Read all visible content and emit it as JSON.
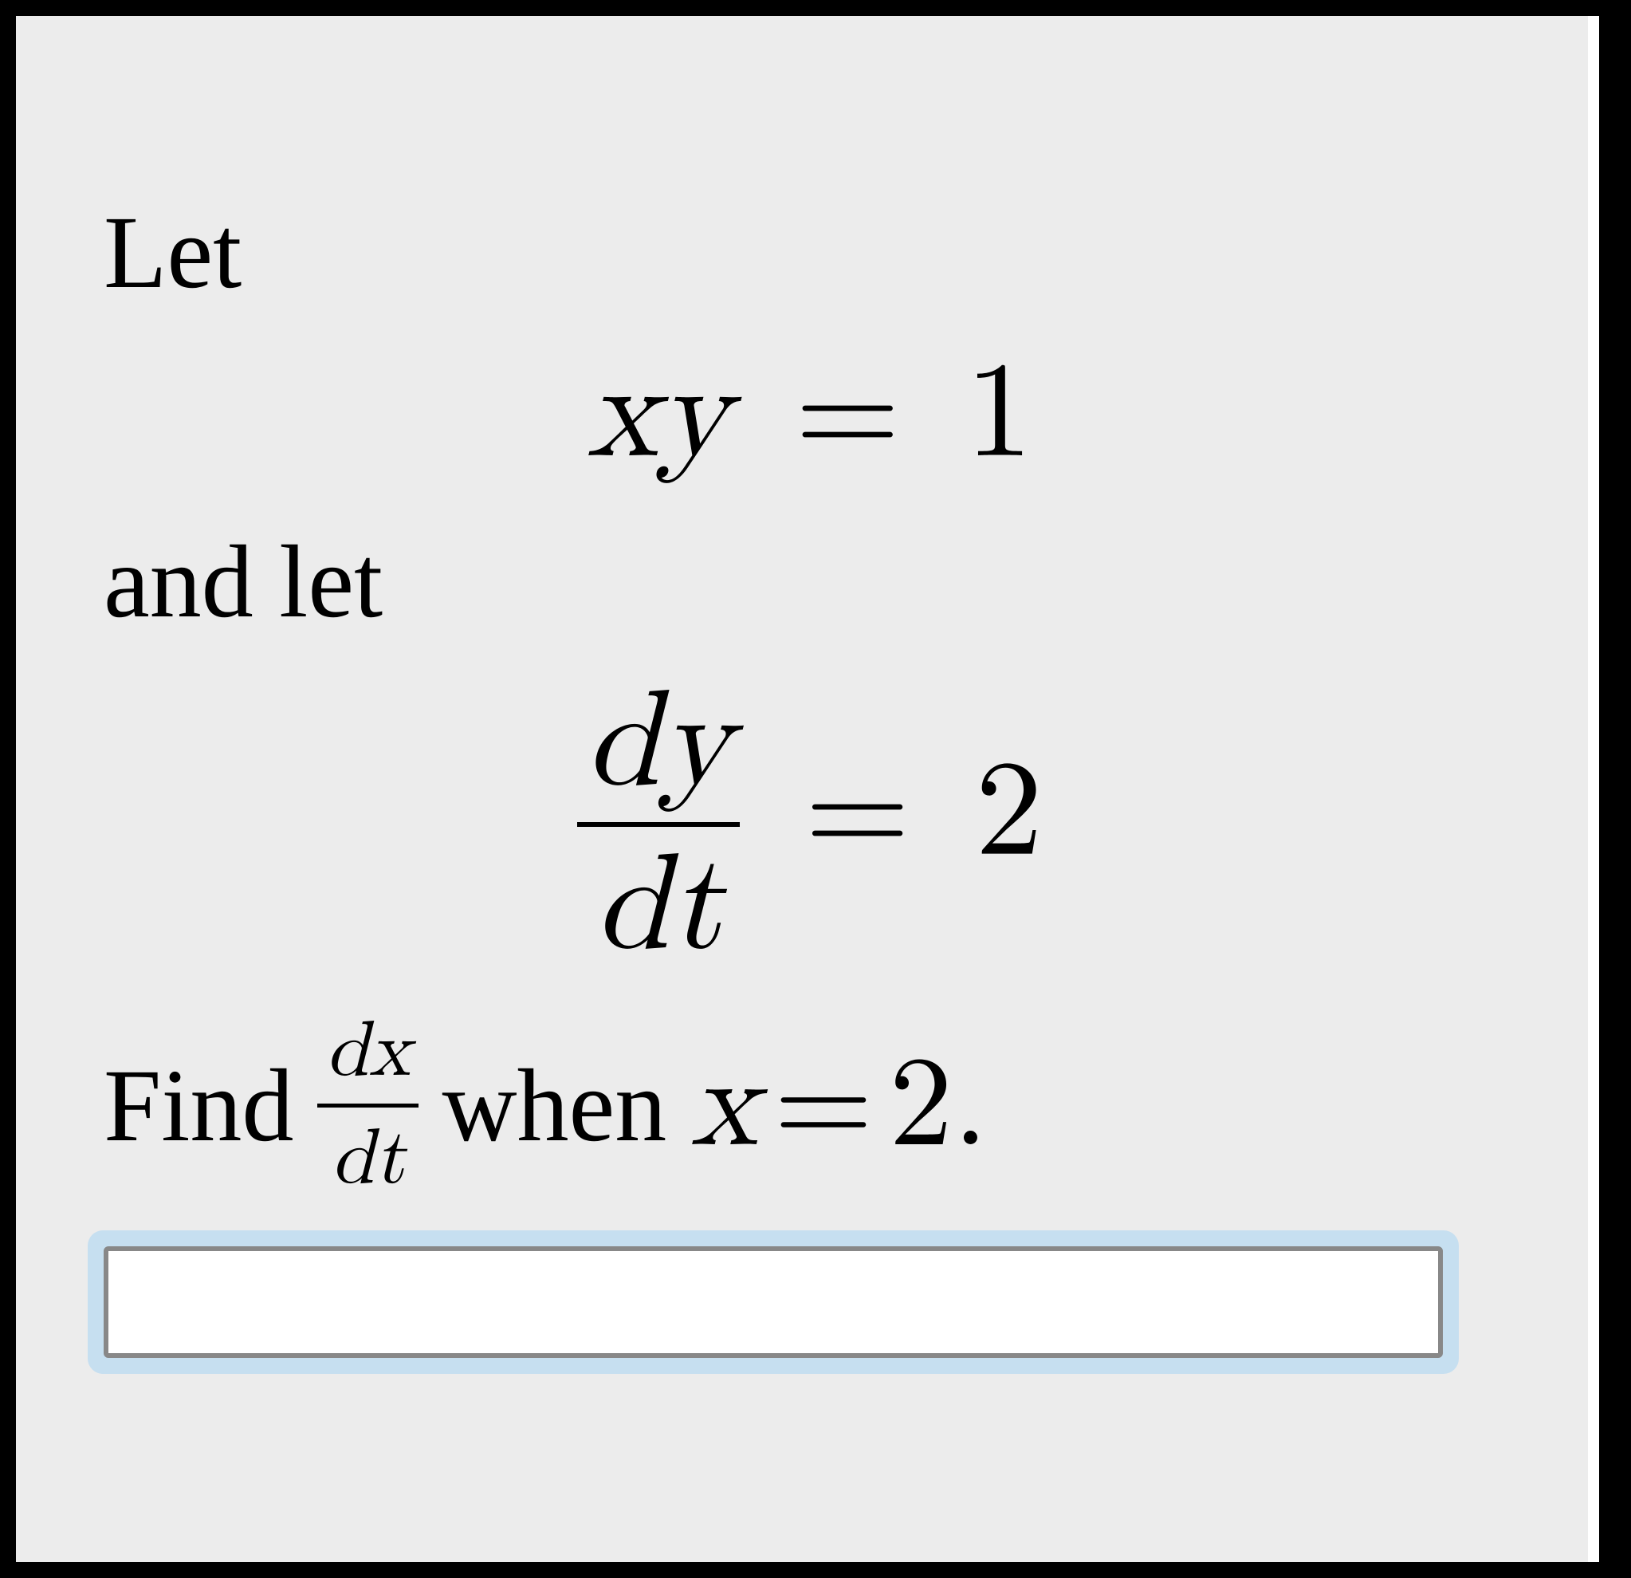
{
  "problem": {
    "let_text": "Let",
    "equation1": {
      "lhs": "xy",
      "rhs": "1"
    },
    "and_let_text": "and let",
    "equation2": {
      "frac_num": "dy",
      "frac_den": "dt",
      "rhs": "2"
    },
    "find_text": "Find",
    "find_frac": {
      "num": "dx",
      "den": "dt"
    },
    "when_text": "when",
    "condition": {
      "var": "x",
      "val": "2"
    },
    "period": "."
  },
  "answer": {
    "value": "",
    "placeholder": ""
  }
}
